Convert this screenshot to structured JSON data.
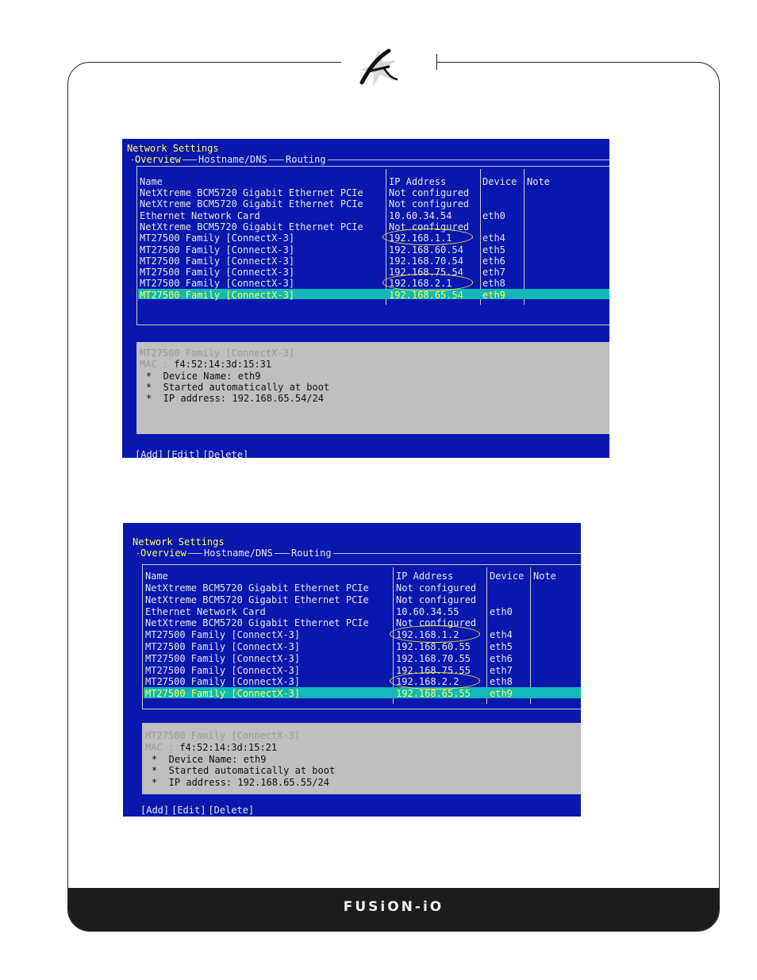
{
  "brand": {
    "footer_logo": "FUSiON-iO",
    "icon": "fusion-io-emblem-icon"
  },
  "screens": [
    {
      "title": "Network Settings",
      "tabs": [
        "Overview",
        "Hostname/DNS",
        "Routing"
      ],
      "columns": [
        "Name",
        "IP Address",
        "Device",
        "Note"
      ],
      "rows": [
        {
          "name": "NetXtreme BCM5720 Gigabit Ethernet PCIe",
          "ip": "Not configured",
          "device": ""
        },
        {
          "name": "NetXtreme BCM5720 Gigabit Ethernet PCIe",
          "ip": "Not configured",
          "device": ""
        },
        {
          "name": "Ethernet Network Card",
          "ip": "10.60.34.54",
          "device": "eth0"
        },
        {
          "name": "NetXtreme BCM5720 Gigabit Ethernet PCIe",
          "ip": "Not configured",
          "device": ""
        },
        {
          "name": "MT27500 Family [ConnectX-3]",
          "ip": "192.168.1.1",
          "device": "eth4"
        },
        {
          "name": "MT27500 Family [ConnectX-3]",
          "ip": "192.168.60.54",
          "device": "eth5"
        },
        {
          "name": "MT27500 Family [ConnectX-3]",
          "ip": "192.168.70.54",
          "device": "eth6"
        },
        {
          "name": "MT27500 Family [ConnectX-3]",
          "ip": "192.168.75.54",
          "device": "eth7"
        },
        {
          "name": "MT27500 Family [ConnectX-3]",
          "ip": "192.168.2.1",
          "device": "eth8"
        },
        {
          "name": "MT27500 Family [ConnectX-3]",
          "ip": "192.168.65.54",
          "device": "eth9"
        }
      ],
      "selected_row": 9,
      "highlighted_rows": [
        4,
        8
      ],
      "detail": {
        "name": "MT27500 Family [ConnectX-3]",
        "mac_label": "MAC :",
        "mac": "f4:52:14:3d:15:31",
        "lines": [
          "*  Device Name: eth9",
          "*  Started automatically at boot",
          "*  IP address: 192.168.65.54/24"
        ]
      },
      "buttons": [
        "[Add]",
        "[Edit]",
        "[Delete]"
      ]
    },
    {
      "title": "Network Settings",
      "tabs": [
        "Overview",
        "Hostname/DNS",
        "Routing"
      ],
      "columns": [
        "Name",
        "IP Address",
        "Device",
        "Note"
      ],
      "rows": [
        {
          "name": "NetXtreme BCM5720 Gigabit Ethernet PCIe",
          "ip": "Not configured",
          "device": ""
        },
        {
          "name": "NetXtreme BCM5720 Gigabit Ethernet PCIe",
          "ip": "Not configured",
          "device": ""
        },
        {
          "name": "Ethernet Network Card",
          "ip": "10.60.34.55",
          "device": "eth0"
        },
        {
          "name": "NetXtreme BCM5720 Gigabit Ethernet PCIe",
          "ip": "Not configured",
          "device": ""
        },
        {
          "name": "MT27500 Family [ConnectX-3]",
          "ip": "192.168.1.2",
          "device": "eth4"
        },
        {
          "name": "MT27500 Family [ConnectX-3]",
          "ip": "192.168.60.55",
          "device": "eth5"
        },
        {
          "name": "MT27500 Family [ConnectX-3]",
          "ip": "192.168.70.55",
          "device": "eth6"
        },
        {
          "name": "MT27500 Family [ConnectX-3]",
          "ip": "192.168.75.55",
          "device": "eth7"
        },
        {
          "name": "MT27500 Family [ConnectX-3]",
          "ip": "192.168.2.2",
          "device": "eth8"
        },
        {
          "name": "MT27500 Family [ConnectX-3]",
          "ip": "192.168.65.55",
          "device": "eth9"
        }
      ],
      "selected_row": 9,
      "highlighted_rows": [
        4,
        8
      ],
      "detail": {
        "name": "MT27500 Family [ConnectX-3]",
        "mac_label": "MAC :",
        "mac": "f4:52:14:3d:15:21",
        "lines": [
          "*  Device Name: eth9",
          "*  Started automatically at boot",
          "*  IP address: 192.168.65.55/24"
        ]
      },
      "buttons": [
        "[Add]",
        "[Edit]",
        "[Delete]"
      ]
    }
  ],
  "colors": {
    "terminal_bg": "#0a17ae",
    "selection": "#13b8b8",
    "selected_text": "#ffff55",
    "annotation": "#f2e23a",
    "footer_bg": "#1c1c1c"
  }
}
